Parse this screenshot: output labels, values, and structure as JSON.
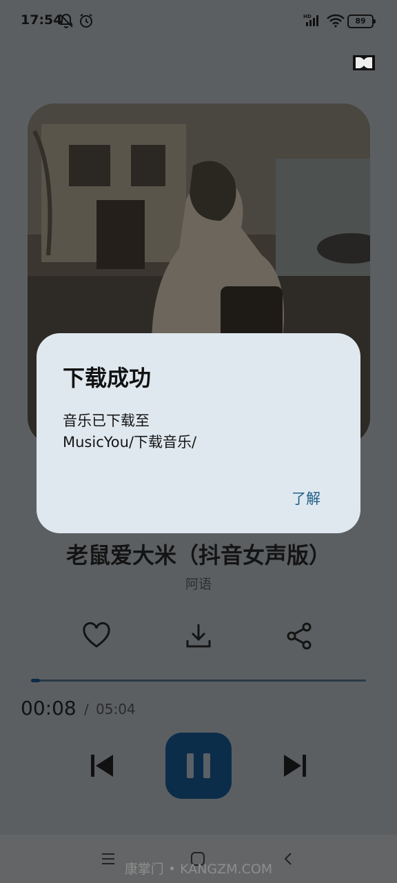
{
  "status_bar": {
    "time": "17:54",
    "battery": "89",
    "icons": [
      "mute-notifications-icon",
      "alarm-icon",
      "hd-signal-icon",
      "wifi-icon",
      "battery-icon"
    ]
  },
  "player": {
    "dolby_icon": "dolby-icon",
    "song_title": "老鼠爱大米（抖音女声版）",
    "artist": "阿语",
    "actions": [
      "heart-icon",
      "download-icon",
      "share-icon"
    ],
    "current_time": "00:08",
    "separator": "/",
    "total_time": "05:04",
    "progress_fraction": 0.026,
    "controls": [
      "skip-previous-icon",
      "pause-icon",
      "skip-next-icon"
    ]
  },
  "dialog": {
    "title": "下载成功",
    "message_line1": "音乐已下载至",
    "message_line2": "MusicYou/下载音乐/",
    "confirm_label": "了解"
  },
  "nav_bar": {
    "icons": [
      "menu-icon",
      "home-icon",
      "back-icon"
    ]
  },
  "watermark": "康掌门 • KANGZM.COM",
  "colors": {
    "scrim": "#5c5f62",
    "dialog_bg": "#dfe8ef",
    "accent": "#1f5f8a",
    "play_button": "#0b2d4a"
  }
}
